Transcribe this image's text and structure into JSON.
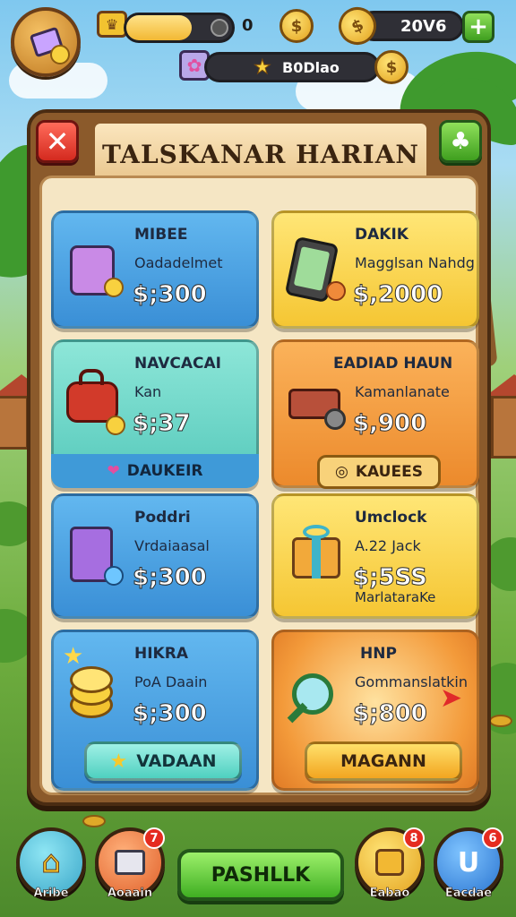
{
  "hud": {
    "level_value": "0",
    "coins_value": "20V6",
    "stars_value": "B0Dlao"
  },
  "panel": {
    "title": "TALSKANAR HARIAN"
  },
  "cards": [
    {
      "name": "MIBEE",
      "sub": "Oadadelmet",
      "price": "$;300",
      "extra": "",
      "tag": ""
    },
    {
      "name": "DAKIK",
      "sub": "Magglsan Nahdg",
      "price": "$,2000",
      "extra": "",
      "tag": ""
    },
    {
      "name": "NAVCACAI",
      "sub": "Kan",
      "price": "$;37",
      "extra": "",
      "tag": "DAUKEIR"
    },
    {
      "name": "EADIAD HAUN",
      "sub": "Kamanlanate",
      "price": "$,900",
      "extra": "",
      "tag": "KAUEES"
    },
    {
      "name": "Poddri",
      "sub": "Vrdaiaasal",
      "price": "$;300",
      "extra": "",
      "tag": ""
    },
    {
      "name": "Umclock",
      "sub": "A.22 Jack",
      "price": "$;5SS",
      "extra": "MarlataraKe",
      "tag": ""
    },
    {
      "name": "HIKRA",
      "sub": "PoA Daain",
      "price": "$;300",
      "extra": "",
      "button": "VADAAN"
    },
    {
      "name": "HNP",
      "sub": "Gommanslatkin",
      "price": "$;800",
      "extra": "",
      "button": "MAGANN"
    }
  ],
  "nav": {
    "items": [
      {
        "label": "Aribe",
        "badge": ""
      },
      {
        "label": "Aoaain",
        "badge": "7"
      },
      {
        "label": "Eabao",
        "badge": "8"
      },
      {
        "label": "Eacdae",
        "badge": "6"
      }
    ],
    "main_button": "PASHLLK"
  },
  "colors": {
    "wood": "#8b5a2b",
    "parchment": "#f5e6c4",
    "blue_card": "#3a8fd6",
    "yellow_card": "#f5c633",
    "teal_card": "#56c9bb",
    "orange_card": "#ec8a2c",
    "close_red": "#d42a1f",
    "action_green": "#3fae22"
  }
}
